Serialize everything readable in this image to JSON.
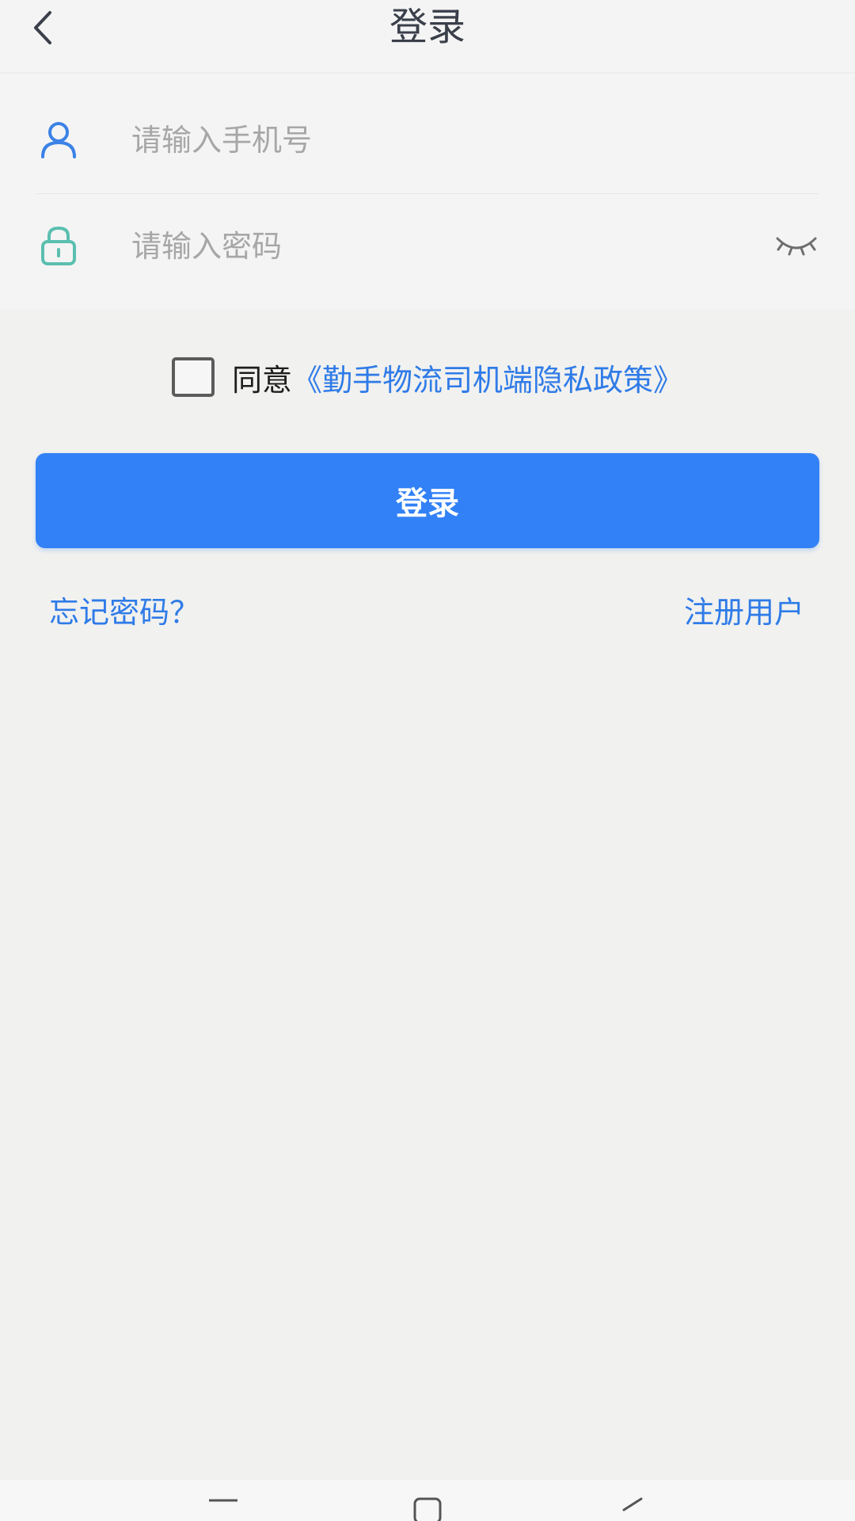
{
  "header": {
    "title": "登录"
  },
  "form": {
    "phone": {
      "placeholder": "请输入手机号",
      "value": ""
    },
    "password": {
      "placeholder": "请输入密码",
      "value": ""
    }
  },
  "agreement": {
    "checked": false,
    "prefix": "同意",
    "policy_link": "《勤手物流司机端隐私政策》"
  },
  "login_button": {
    "label": "登录"
  },
  "links": {
    "forgot_password": "忘记密码？",
    "register": "注册用户"
  },
  "colors": {
    "primary": "#3281f6",
    "link": "#2f7be8",
    "user_icon": "#3b82e6",
    "lock_icon": "#5bbfb0",
    "background": "#f1f1ef"
  },
  "icons": {
    "back": "chevron-left-icon",
    "user": "user-icon",
    "lock": "lock-icon",
    "eye": "eye-closed-icon",
    "nav_menu": "menu-icon",
    "nav_home": "home-square-icon",
    "nav_back": "back-triangle-icon"
  }
}
